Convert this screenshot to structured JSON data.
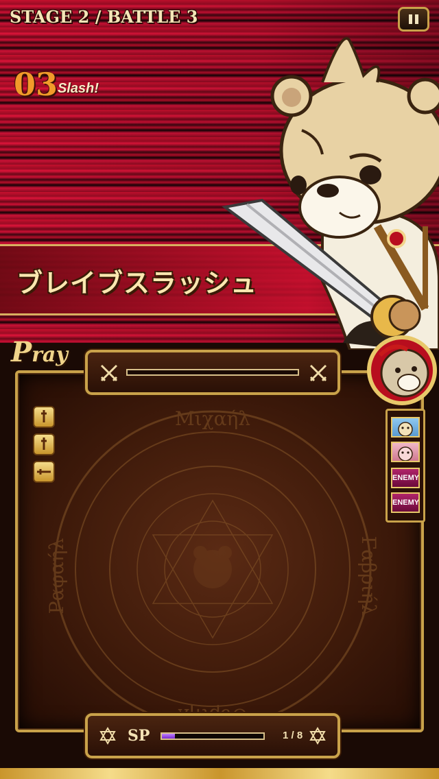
{
  "hud": {
    "stage_label": "STAGE 2 / BATTLE  3",
    "pause_icon": "pause-icon"
  },
  "combo": {
    "count": "03",
    "label": "Slash!"
  },
  "skill": {
    "name": "ブレイブスラッシュ"
  },
  "panel": {
    "title_initial": "P",
    "title_rest": "ray",
    "target_icons": [
      "crossed-swords-icon",
      "crossed-swords-icon"
    ],
    "queue_icons": [
      "sword-icon",
      "sword-icon",
      "sword-sideways-icon"
    ],
    "magic_circle_words": [
      "Μιχαήλ",
      "Γαβριήλ",
      "Ουριήλ",
      "Ραφαήλ"
    ]
  },
  "sp": {
    "label": "SP",
    "current": 1,
    "max": 8,
    "count_text": "1 / 8"
  },
  "turn_order": {
    "slots": [
      {
        "type": "ally",
        "icon": "bear-portrait-blue"
      },
      {
        "type": "ally",
        "icon": "bear-portrait-pink"
      },
      {
        "type": "enemy",
        "label": "ENEMY"
      },
      {
        "type": "enemy",
        "label": "ENEMY"
      }
    ]
  },
  "colors": {
    "accent_gold": "#c9a24a",
    "battle_red": "#c8102e",
    "combo_orange": "#f29a2a",
    "sp_purple": "#9b4de8"
  }
}
